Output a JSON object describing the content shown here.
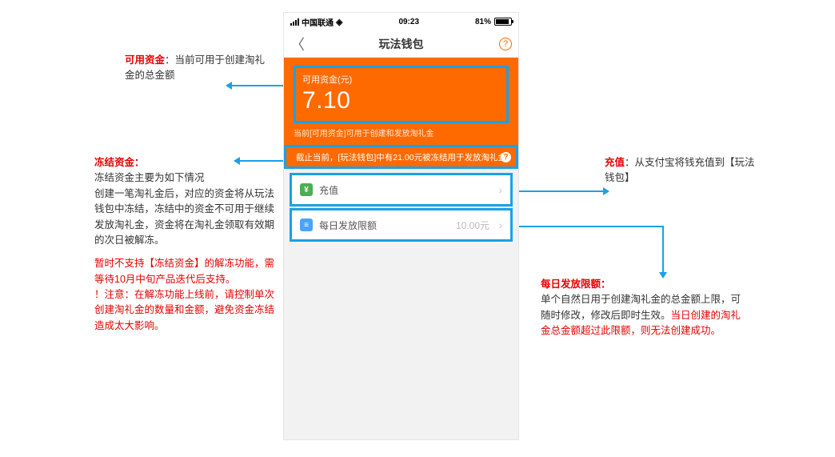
{
  "statusbar": {
    "carrier": "中国联通",
    "time": "09:23",
    "battery_pct": "81%"
  },
  "navbar": {
    "title": "玩法钱包",
    "back_glyph": "〈",
    "help_glyph": "?"
  },
  "balance": {
    "label": "可用资金(元)",
    "amount": "7.10",
    "note": "当前[可用资金]可用于创建和发放淘礼金"
  },
  "frozen_strip": {
    "text": "截止当前，[玩法钱包]中有21.00元被冻结用于发放淘礼金",
    "help_glyph": "?"
  },
  "rows": {
    "recharge": {
      "label": "充值",
      "chev": "›"
    },
    "daily": {
      "label": "每日发放限额",
      "value": "10.00元",
      "chev": "›"
    }
  },
  "anno": {
    "available": {
      "title": "可用资金",
      "body": "：当前可用于创建淘礼金的总金额"
    },
    "frozen": {
      "title": "冻结资金：",
      "p1": "冻结资金主要为如下情况",
      "p2": "创建一笔淘礼金后，对应的资金将从玩法钱包中冻结，冻结中的资金不可用于继续发放淘礼金，资金将在淘礼金领取有效期的次日被解冻。",
      "p3": "暂时不支持【冻结资金】的解冻功能，需等待10月中旬产品迭代后支持。",
      "p4": "！注意：在解冻功能上线前，请控制单次创建淘礼金的数量和金额，避免资金冻结造成太大影响。"
    },
    "recharge": {
      "title": "充值",
      "body": "：从支付宝将钱充值到【玩法钱包】"
    },
    "daily": {
      "title": "每日发放限额：",
      "body1": "单个自然日用于创建淘礼金的总金额上限，可随时修改，修改后即时生效。",
      "body2": "当日创建的淘礼金总金额超过此限额，则无法创建成功。"
    }
  }
}
